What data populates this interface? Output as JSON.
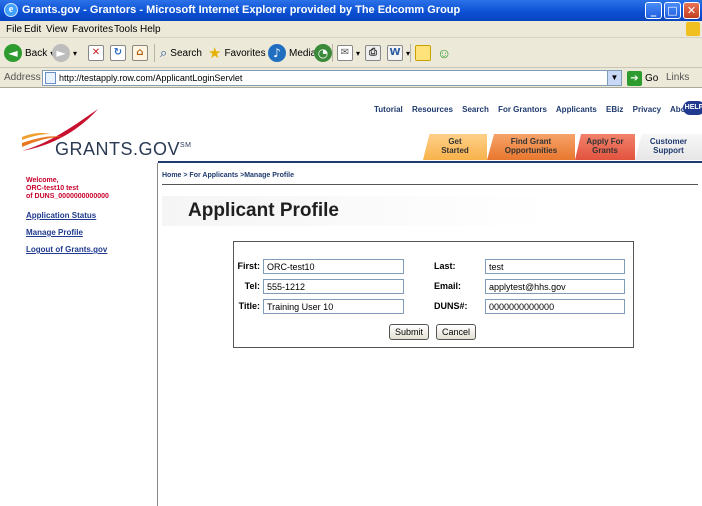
{
  "window": {
    "title": "Grants.gov - Grantors - Microsoft Internet Explorer provided by The Edcomm Group",
    "controls": {
      "minimize": "_",
      "maximize": "□",
      "close": "✕"
    }
  },
  "menu": [
    "File",
    "Edit",
    "View",
    "Favorites",
    "Tools",
    "Help"
  ],
  "toolbar": {
    "back": "Back",
    "search": "Search",
    "favorites": "Favorites",
    "media": "Media"
  },
  "address": {
    "label": "Address",
    "url": "http://testapply.row.com/ApplicantLoginServlet",
    "go": "Go",
    "links": "Links"
  },
  "site": {
    "brand": "GRANTS.GOV",
    "brand_mark": "SM",
    "help": "HELP",
    "top_nav": [
      "Tutorial",
      "Resources",
      "Search",
      "For Grantors",
      "Applicants",
      "EBiz",
      "Privacy",
      "About Us"
    ],
    "tabs": [
      {
        "line1": "Get",
        "line2": "Started"
      },
      {
        "line1": "Find Grant",
        "line2": "Opportunities"
      },
      {
        "line1": "Apply For",
        "line2": "Grants"
      },
      {
        "line1": "Customer",
        "line2": "Support"
      }
    ],
    "colors": {
      "navy": "#1f3a6e",
      "welcome_red": "#c8002b",
      "link_blue": "#1f3a8f"
    }
  },
  "sidebar": {
    "welcome": "Welcome,",
    "user": "ORC-test10 test",
    "duns": "of DUNS_0000000000000",
    "links": [
      "Application Status",
      "Manage Profile",
      "Logout of Grants.gov"
    ]
  },
  "breadcrumb": "Home > For Applicants >Manage Profile",
  "heading": "Applicant Profile",
  "form": {
    "first_label": "First:",
    "first_value": "ORC-test10",
    "last_label": "Last:",
    "last_value": "test",
    "tel_label": "Tel:",
    "tel_value": "555-1212",
    "email_label": "Email:",
    "email_value": "applytest@hhs.gov",
    "title_label": "Title:",
    "title_value": "Training User 10",
    "duns_label": "DUNS#:",
    "duns_value": "0000000000000",
    "submit": "Submit",
    "cancel": "Cancel"
  }
}
